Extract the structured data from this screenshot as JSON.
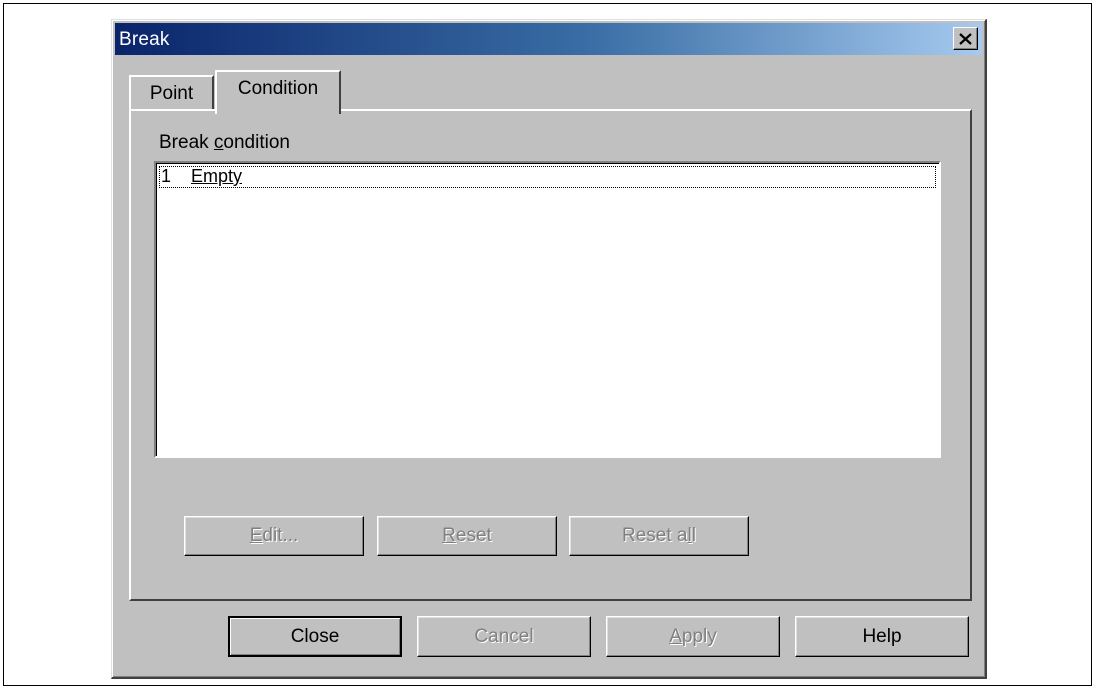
{
  "window": {
    "title": "Break"
  },
  "tabs": [
    {
      "label": "Point",
      "selected": false
    },
    {
      "label": "Condition",
      "selected": true
    }
  ],
  "panel": {
    "group_label_prefix": "Break ",
    "group_label_mnemonic": "c",
    "group_label_suffix": "ondition",
    "list": [
      {
        "number": "1",
        "text": "Empty",
        "focused": true
      }
    ],
    "buttons": {
      "edit": {
        "mnemonic": "E",
        "rest": "dit...",
        "enabled": false
      },
      "reset": {
        "mnemonic": "R",
        "rest": "eset",
        "enabled": false
      },
      "reset_all": {
        "prefix": "Reset a",
        "mnemonic": "l",
        "suffix": "l",
        "enabled": false
      }
    }
  },
  "footer": {
    "close": {
      "label": "Close",
      "enabled": true
    },
    "cancel": {
      "label": "Cancel",
      "enabled": false
    },
    "apply": {
      "mnemonic": "A",
      "rest": "pply",
      "enabled": false
    },
    "help": {
      "label": "Help",
      "enabled": true
    }
  },
  "colors": {
    "face": "#c0c0c0",
    "title_gradient_start": "#0a246a",
    "title_gradient_end": "#a6caf0",
    "disabled_text": "#808080"
  }
}
